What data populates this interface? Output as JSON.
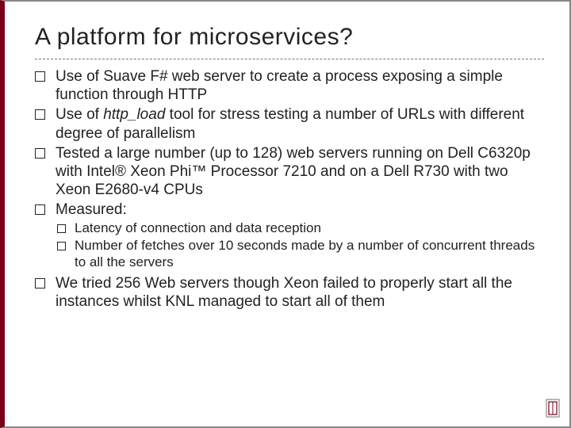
{
  "title": "A platform for microservices?",
  "bullets": {
    "b1_a": "Use of Suave F# web server to create a process exposing a simple function through HTTP",
    "b2_a": "Use of ",
    "b2_i": "http_load",
    "b2_c": " tool for stress testing a number of URLs with different degree of parallelism",
    "b3": "Tested a large number (up to 128) web servers running on Dell C6320p with Intel® Xeon Phi™ Processor 7210 and on a Dell R730 with two Xeon E2680-v4 CPUs",
    "b4": "Measured:",
    "b4_1": "Latency of connection and data reception",
    "b4_2": "Number of fetches over 10 seconds made by a number of concurrent threads to all the servers",
    "b5": "We tried 256 Web servers though Xeon failed to properly start all the instances whilst KNL managed to start all of them"
  }
}
